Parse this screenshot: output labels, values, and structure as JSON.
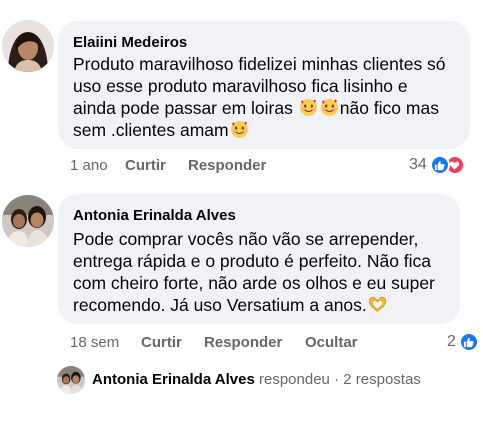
{
  "comments": [
    {
      "author": "Elaiini Medeiros",
      "lines": [
        "Produto maravilhoso fidelizei minhas clientes só",
        "uso esse produto maravilhoso fica lisinho  e",
        "ainda pode passar em loiras",
        "não fico mas",
        "sem .clientes  amam"
      ],
      "time": "1 ano",
      "like_label": "Curtir",
      "reply_label": "Responder",
      "reaction_count": "34",
      "reaction_icons": [
        "like-icon",
        "love-icon"
      ],
      "emoji_name": "smiling-face-with-hearts",
      "colors": {
        "like": "#1877f2",
        "love": "#f33e58"
      }
    },
    {
      "author": "Antonia Erinalda Alves",
      "lines": [
        "Pode comprar vocês não vão se arrepender,",
        "entrega rápida e o produto é perfeito. Não fica",
        "com cheiro forte, não arde os olhos e eu super",
        "recomendo. Já uso Versatium a anos."
      ],
      "time": "18 sem",
      "like_label": "Curtir",
      "reply_label": "Responder",
      "hide_label": "Ocultar",
      "reaction_count": "2",
      "reaction_icons": [
        "like-icon"
      ],
      "emoji_name": "heart-hands"
    }
  ],
  "thread": {
    "author": "Antonia Erinalda Alves",
    "action": "respondeu",
    "separator": "·",
    "replies": "2 respostas"
  },
  "colors": {
    "bubble": "#f0f2f5",
    "meta": "#65676b",
    "text": "#050505"
  }
}
